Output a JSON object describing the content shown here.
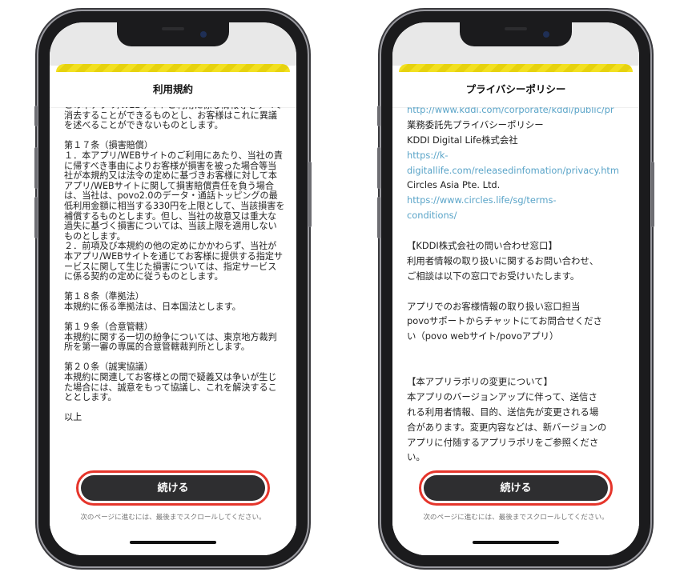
{
  "left_phone": {
    "title": "利用規約",
    "body": "この本アプリ/WEBサイトご利用に係る情報等をすべて消去することができるものとし、お客様はこれに異議を述べることができないものとします。\n\n第１７条（損害賠償）\n１．本アプリ/WEBサイトのご利用にあたり、当社の責に帰すべき事由によりお客様が損害を被った場合等当社が本規約又は法令の定めに基づきお客様に対して本アプリ/WEBサイトに関して損害賠償責任を負う場合は、当社は、povo2.0のデータ・通話トッピングの最低利用金額に相当する330円を上限として、当該損害を補償するものとします。但し、当社の故意又は重大な過失に基づく損害については、当該上限を適用しないものとします。\n２．前項及び本規約の他の定めにかかわらず、当社が本アプリ/WEBサイトを通じてお客様に提供する指定サービスに関して生じた損害については、指定サービスに係る契約の定めに従うものとします。\n\n第１８条（準拠法）\n本規約に係る準拠法は、日本国法とします。\n\n第１９条（合意管轄）\n本規約に関する一切の紛争については、東京地方裁判所を第一審の専属的合意管轄裁判所とします。\n\n第２０条（誠実協議）\n本規約に関連してお客様との間で疑義又は争いが生じた場合には、誠意をもって協議し、これを解決することとします。\n\n以上",
    "button": "続ける",
    "hint": "次のページに進むには、最後までスクロールしてください。"
  },
  "right_phone": {
    "title": "プライバシーポリシー",
    "lines": [
      {
        "text": "http://www.kddi.com/corporate/kddi/public/pr",
        "link": true
      },
      {
        "text": "業務委託先プライバシーポリシー",
        "link": false
      },
      {
        "text": "KDDI Digital Life株式会社",
        "link": false
      },
      {
        "text": "https://k-",
        "link": true
      },
      {
        "text": "digitallife.com/releasedinfomation/privacy.htm",
        "link": true
      },
      {
        "text": "Circles Asia Pte. Ltd.",
        "link": false
      },
      {
        "text": "https://www.circles.life/sg/terms-",
        "link": true
      },
      {
        "text": "conditions/",
        "link": true
      },
      {
        "text": "",
        "link": false
      },
      {
        "text": "【KDDI株式会社の問い合わせ窓口】",
        "link": false
      },
      {
        "text": "利用者情報の取り扱いに関するお問い合わせ、",
        "link": false
      },
      {
        "text": "ご相談は以下の窓口でお受けいたします。",
        "link": false
      },
      {
        "text": "",
        "link": false
      },
      {
        "text": "アプリでのお客様情報の取り扱い窓口担当",
        "link": false
      },
      {
        "text": "povoサポートからチャットにてお問合せくださ",
        "link": false
      },
      {
        "text": "い（povo webサイト/povoアプリ）",
        "link": false
      },
      {
        "text": "",
        "link": false
      },
      {
        "text": "",
        "link": false
      },
      {
        "text": "【本アプリラポリの変更について】",
        "link": false
      },
      {
        "text": "本アプリのバージョンアップに伴って、送信さ",
        "link": false
      },
      {
        "text": "れる利用者情報、目的、送信先が変更される場",
        "link": false
      },
      {
        "text": "合があります。変更内容などは、新バージョンの",
        "link": false
      },
      {
        "text": "アプリに付随するアプリラポリをご参照くださ",
        "link": false
      },
      {
        "text": "い。",
        "link": false
      }
    ],
    "button": "続ける",
    "hint": "次のページに進むには、最後までスクロールしてください。"
  },
  "colors": {
    "highlight": "#e5352b",
    "button": "#2e2e30",
    "link": "#5aa4c8",
    "banner": "#f2e020"
  }
}
